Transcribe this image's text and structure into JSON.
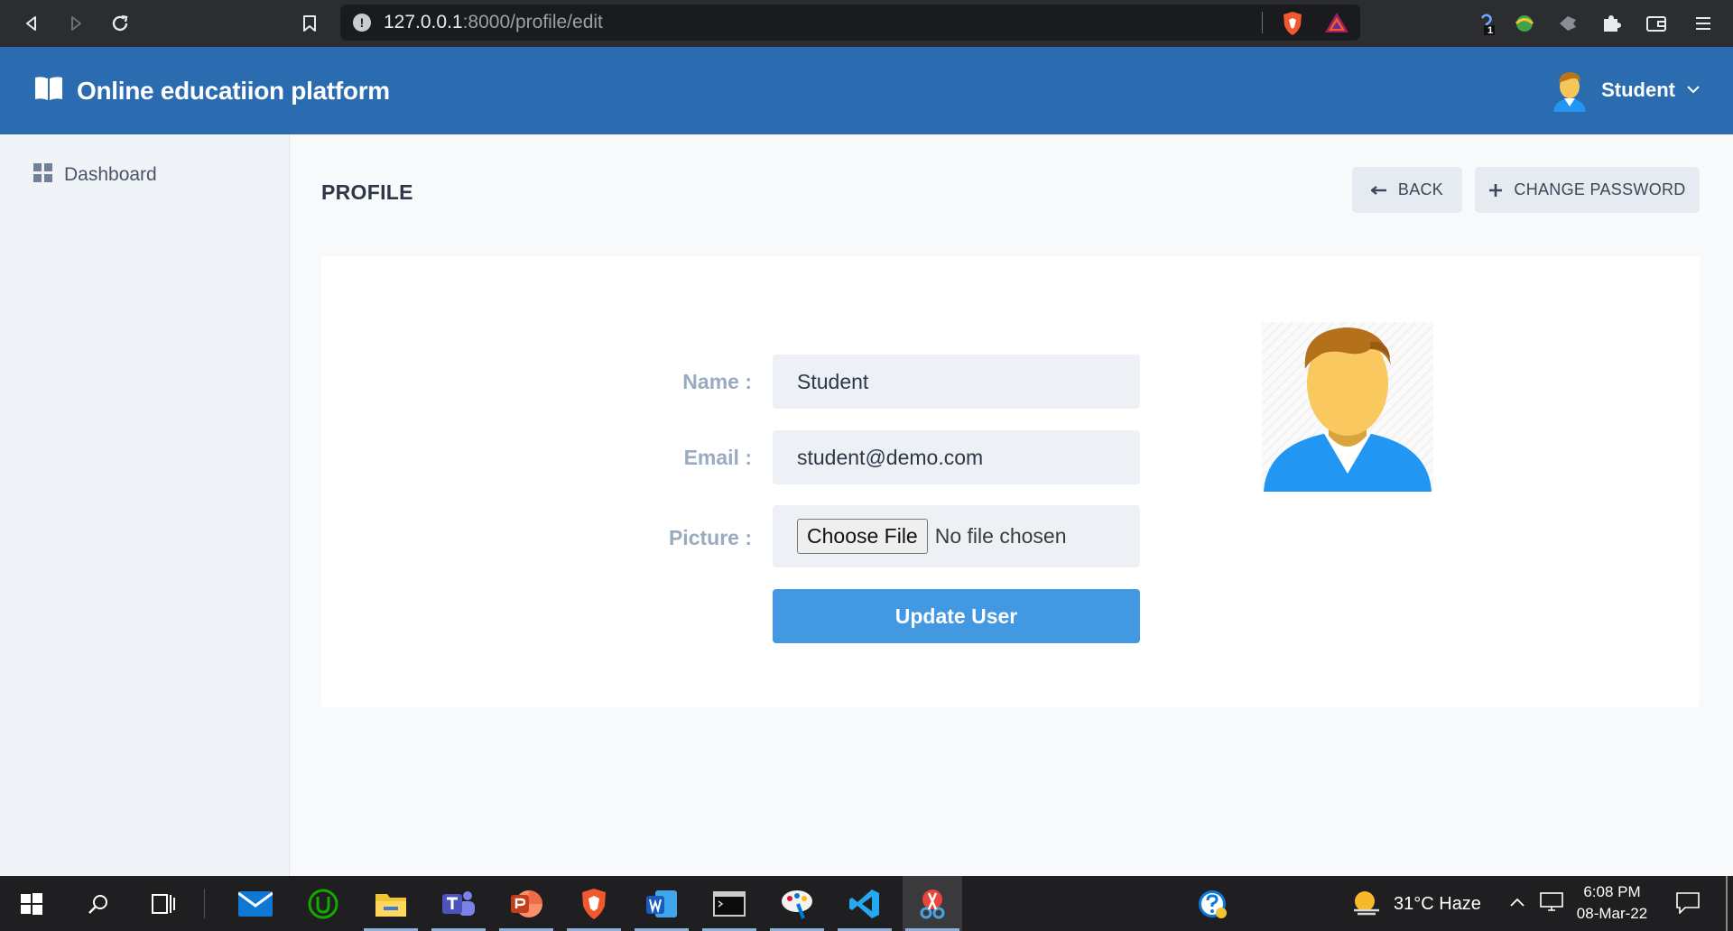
{
  "browser": {
    "url_host": "127.0.0.1",
    "url_path": ":8000/profile/edit",
    "icons": [
      "back-icon",
      "forward-icon",
      "reload-icon",
      "bookmark-icon",
      "site-info-icon",
      "brave-shields-icon",
      "brave-rewards-icon",
      "extension-icon",
      "puzzle-icon",
      "wallet-icon",
      "menu-icon"
    ],
    "extension_badge": "1"
  },
  "header": {
    "brand_title": "Online educatiion platform",
    "user_name": "Student",
    "color": "#2b6cb0"
  },
  "sidebar": {
    "items": [
      {
        "label": "Dashboard",
        "icon": "grid-icon"
      }
    ]
  },
  "page": {
    "title": "PROFILE",
    "back_label": "BACK",
    "change_password_label": "CHANGE PASSWORD"
  },
  "form": {
    "name_label": "Name :",
    "name_value": "Student",
    "email_label": "Email :",
    "email_value": "student@demo.com",
    "picture_label": "Picture :",
    "file_button": "Choose File",
    "file_status": "No file chosen",
    "submit_label": "Update User",
    "submit_color": "#4299e1"
  },
  "taskbar": {
    "weather": "31°C  Haze",
    "time": "6:08 PM",
    "date": "08-Mar-22",
    "apps": [
      "windows-start",
      "search",
      "task-view",
      "mail",
      "upwork",
      "file-explorer",
      "teams",
      "powerpoint",
      "brave",
      "word",
      "terminal",
      "paint",
      "vscode",
      "snipping-tool"
    ]
  }
}
